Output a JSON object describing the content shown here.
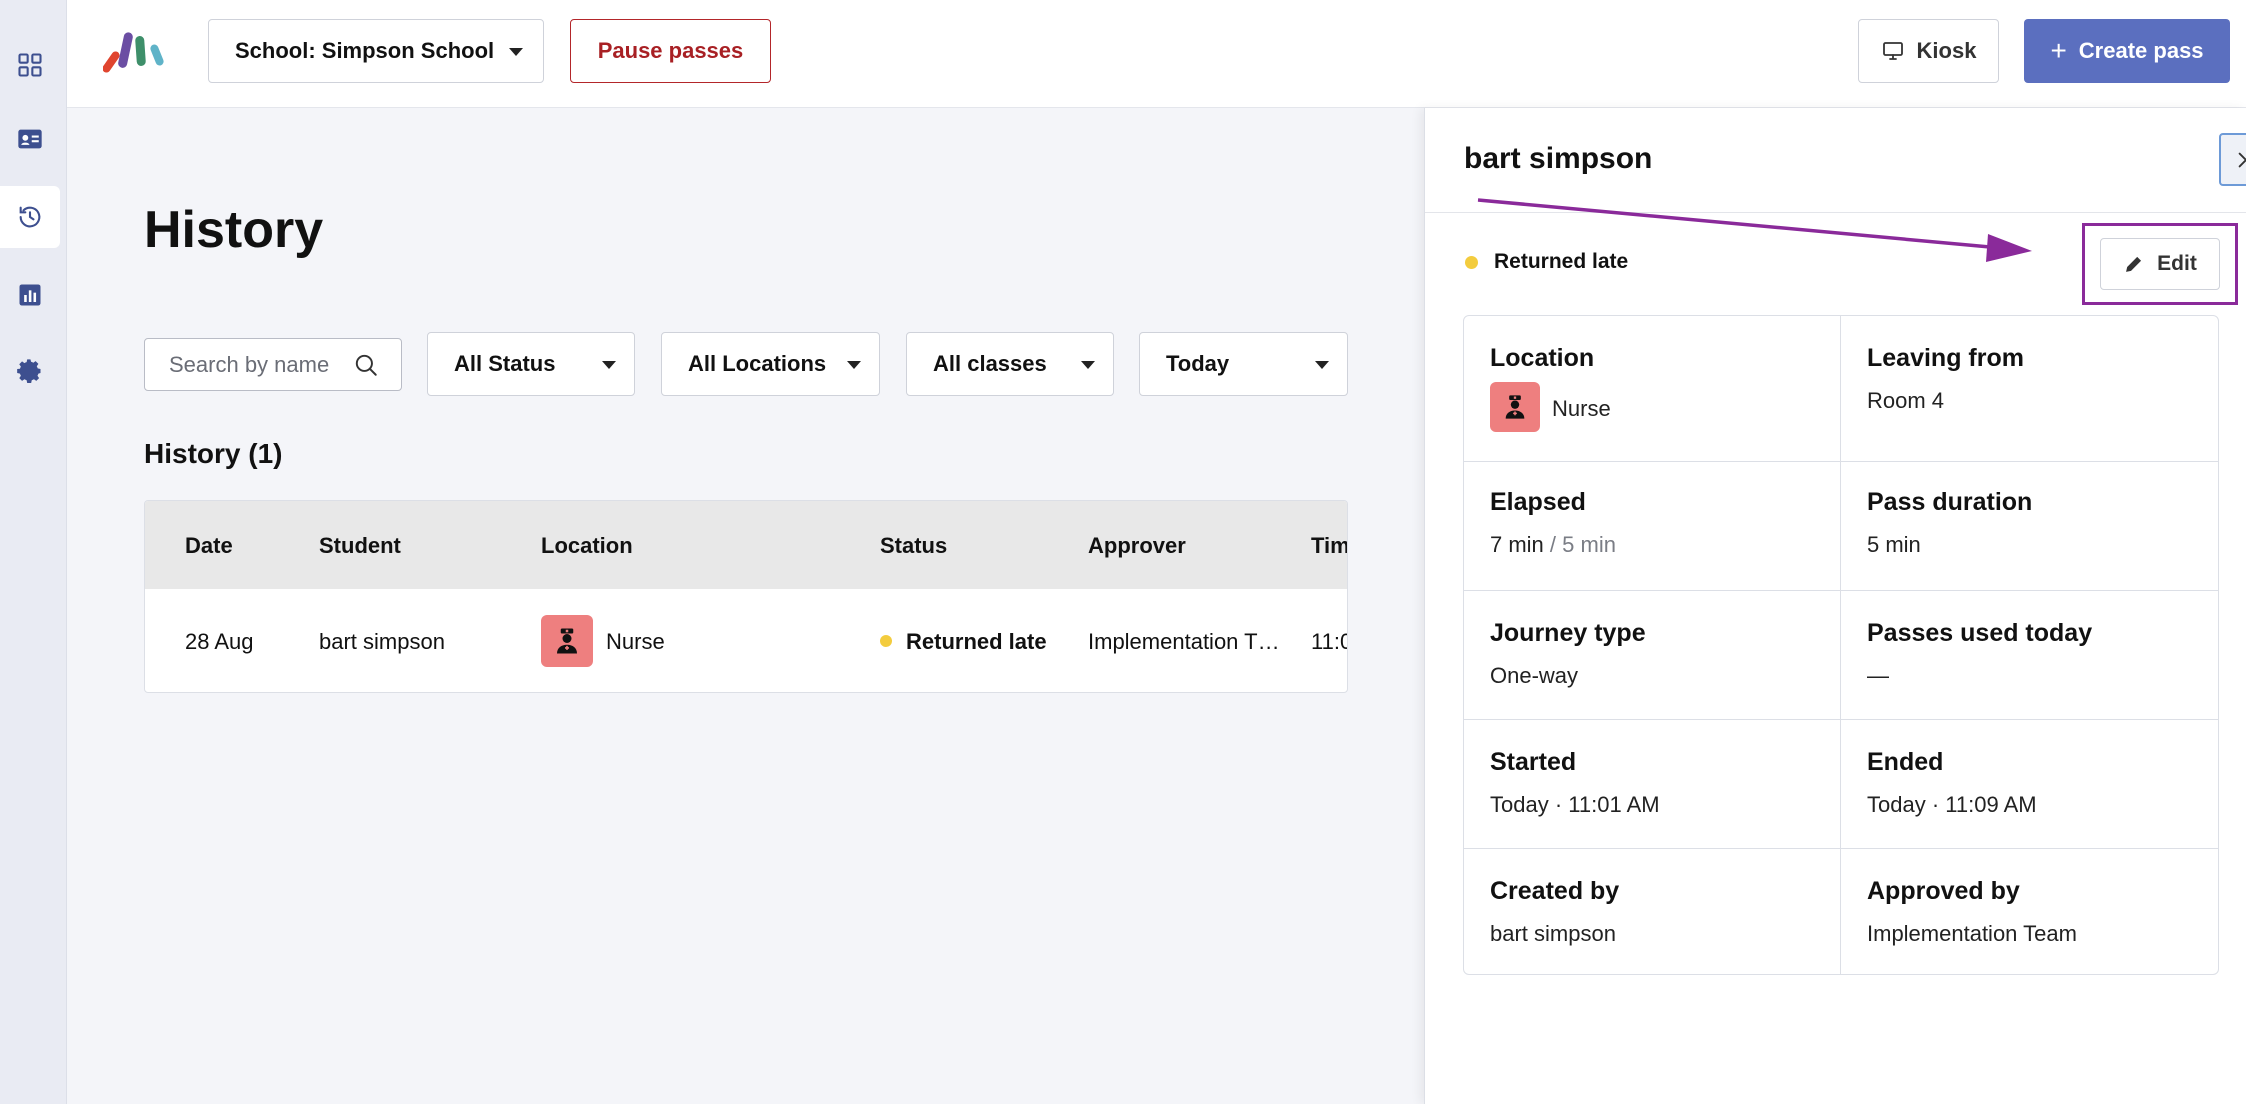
{
  "topbar": {
    "school_label": "School: Simpson School",
    "pause_label": "Pause passes",
    "kiosk_label": "Kiosk",
    "create_label": "Create pass"
  },
  "page": {
    "title": "History",
    "search_placeholder": "Search by name",
    "filters": [
      "All Status",
      "All Locations",
      "All classes",
      "Today"
    ],
    "section_title": "History (1)"
  },
  "table": {
    "headers": [
      "Date",
      "Student",
      "Location",
      "Status",
      "Approver",
      "Tim"
    ],
    "row": {
      "date": "28 Aug",
      "student": "bart simpson",
      "location": "Nurse",
      "status": "Returned late",
      "approver": "Implementation T…",
      "time": "11:0"
    }
  },
  "panel": {
    "title": "bart simpson",
    "status": "Returned late",
    "edit_label": "Edit",
    "fields": {
      "location_label": "Location",
      "location_value": "Nurse",
      "leaving_label": "Leaving from",
      "leaving_value": "Room 4",
      "elapsed_label": "Elapsed",
      "elapsed_value": "7 min",
      "elapsed_limit": "/ 5 min",
      "duration_label": "Pass duration",
      "duration_value": "5 min",
      "journey_label": "Journey type",
      "journey_value": "One-way",
      "passes_label": "Passes used today",
      "passes_value": "—",
      "started_label": "Started",
      "started_value": "Today · 11:01 AM",
      "ended_label": "Ended",
      "ended_value": "Today · 11:09 AM",
      "created_label": "Created by",
      "created_value": "bart simpson",
      "approved_label": "Approved by",
      "approved_value": "Implementation Team"
    }
  },
  "colors": {
    "accent": "#5b6fbf",
    "danger": "#a82024",
    "status_late": "#f3cc3e",
    "nurse_tile": "#ee7f7f",
    "annotation": "#8a2a9a"
  },
  "icons": {
    "rail": [
      "grid-icon",
      "id-card-icon",
      "history-icon",
      "chart-icon",
      "gear-icon"
    ],
    "kiosk": "monitor-icon",
    "search": "search-icon",
    "close": "close-icon",
    "edit": "pencil-icon",
    "nurse": "nurse-icon"
  }
}
